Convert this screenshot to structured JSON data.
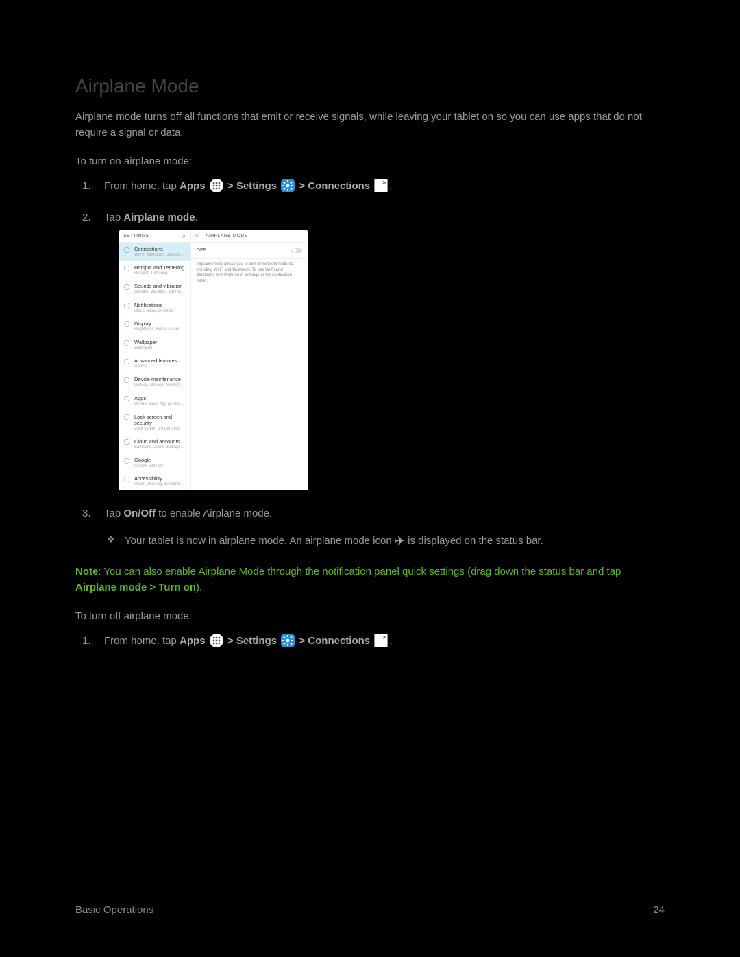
{
  "title": "Airplane Mode",
  "intro": "Airplane mode turns off all functions that emit or receive signals, while leaving your tablet on so you can use apps that do not require a signal or data.",
  "section_on_label": "To turn on airplane mode:",
  "step1": {
    "prefix": "From home, tap ",
    "apps": "Apps",
    "sep1": " > ",
    "settings": "Settings",
    "sep2": " > ",
    "connections": "Connections",
    "suffix": "."
  },
  "step2": {
    "prefix": "Tap ",
    "bold": "Airplane mode",
    "suffix": "."
  },
  "step3": {
    "prefix": "Tap ",
    "bold": "On/Off",
    "suffix": " to enable Airplane mode.",
    "result_before": "Your tablet is now in airplane mode. An airplane mode icon ",
    "result_after": " is displayed on the status bar."
  },
  "note": {
    "label": "Note",
    "sep": ": ",
    "text_a": "You can also enable Airplane Mode through the notification panel quick settings (drag down the status bar and tap ",
    "bold": "Airplane mode > Turn on",
    "text_b": ")."
  },
  "section_off_label": "To turn off airplane mode:",
  "shot": {
    "left_header": "SETTINGS",
    "right_header": "AIRPLANE MODE",
    "off_label": "OFF",
    "desc": "Airplane mode allows you to turn off network features, including Wi-Fi and Bluetooth. To use Wi-Fi and Bluetooth, turn them on in Settings or the notification panel.",
    "items": [
      {
        "t1": "Connections",
        "t2": "Wi-Fi, Bluetooth, Data usage, Airplane m…",
        "color": "#3fa7d6",
        "sel": true
      },
      {
        "t1": "Hotspot and Tethering",
        "t2": "Hotspot, Tethering",
        "color": "#3fa7d6"
      },
      {
        "t1": "Sounds and vibration",
        "t2": "Sounds, Vibration, Do not disturb",
        "color": "#b55bd1"
      },
      {
        "t1": "Notifications",
        "t2": "Block, allow, prioritize",
        "color": "#e26a6a"
      },
      {
        "t1": "Display",
        "t2": "Brightness, Home screen",
        "color": "#5fc58f"
      },
      {
        "t1": "Wallpaper",
        "t2": "Wallpaper",
        "color": "#e78bc3"
      },
      {
        "t1": "Advanced features",
        "t2": "Games",
        "color": "#f2a13e"
      },
      {
        "t1": "Device maintenance",
        "t2": "Battery, Storage, Memory",
        "color": "#5fc58f"
      },
      {
        "t1": "Apps",
        "t2": "Default apps, App permissions",
        "color": "#7c8fd6"
      },
      {
        "t1": "Lock screen and security",
        "t2": "Lock screen, Fingerprints",
        "color": "#6fb5e0"
      },
      {
        "t1": "Cloud and accounts",
        "t2": "Samsung Cloud, Backup and restore",
        "color": "#4aa3df"
      },
      {
        "t1": "Google",
        "t2": "Google settings",
        "color": "#999"
      },
      {
        "t1": "Accessibility",
        "t2": "Vision, Hearing, Dexterity and interaction",
        "color": "#a4c85e"
      }
    ]
  },
  "footer": {
    "section": "Basic Operations",
    "page": "24"
  }
}
